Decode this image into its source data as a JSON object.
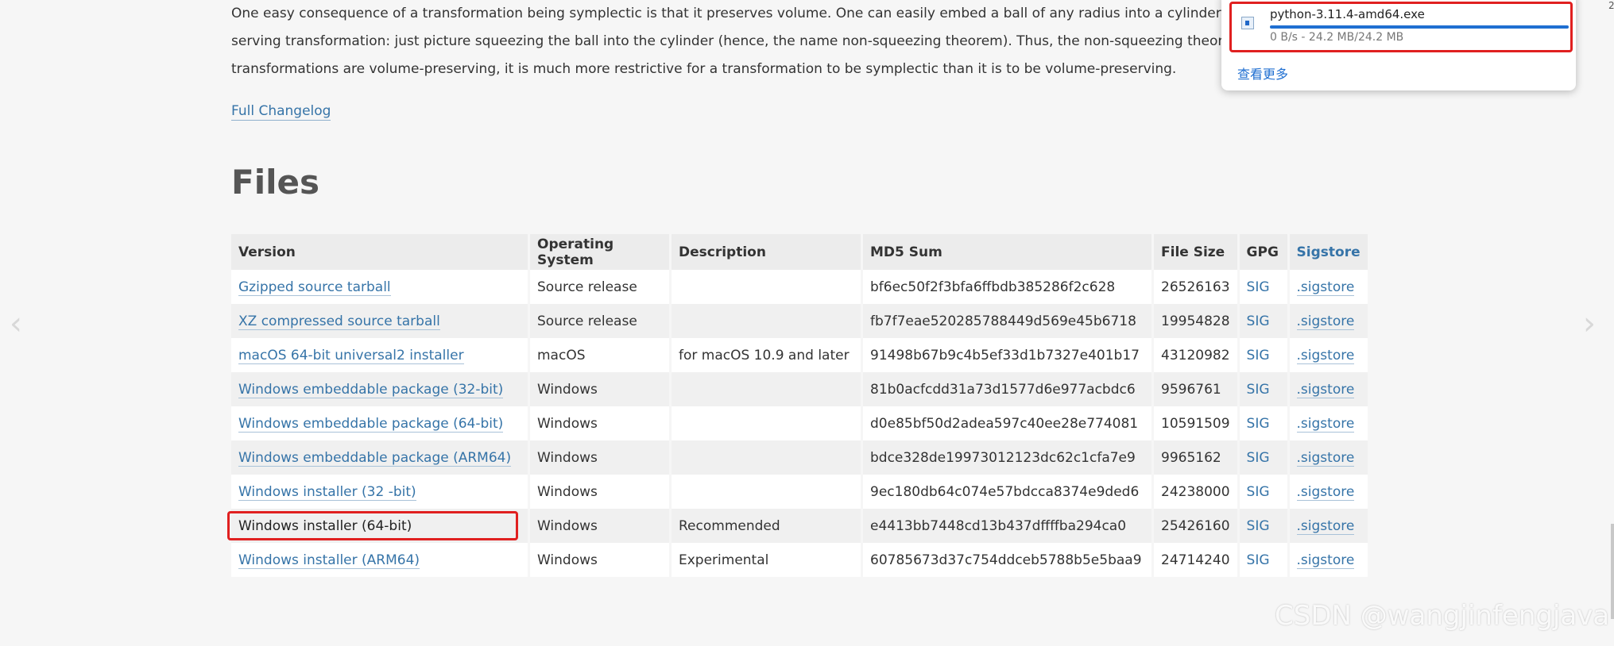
{
  "paragraph": {
    "line1": "One easy consequence of a transformation being symplectic is that it preserves volume. One can easily embed a ball of any radius into a cylinder of any other radi",
    "line2": "serving transformation: just picture squeezing the ball into the cylinder (hence, the name non-squeezing theorem). Thus, the non-squeezing theorem tells us that",
    "line3": "transformations are volume-preserving, it is much more restrictive for a transformation to be symplectic than it is to be volume-preserving."
  },
  "changelog_link": "Full Changelog",
  "files_title": "Files",
  "table": {
    "headers": {
      "version": "Version",
      "os": "Operating System",
      "description": "Description",
      "md5": "MD5 Sum",
      "size": "File Size",
      "gpg": "GPG",
      "sigstore": "Sigstore"
    },
    "rows": [
      {
        "version": "Gzipped source tarball",
        "os": "Source release",
        "description": "",
        "md5": "bf6ec50f2f3bfa6ffbdb385286f2c628",
        "size": "26526163",
        "gpg": "SIG",
        "sigstore": ".sigstore"
      },
      {
        "version": "XZ compressed source tarball",
        "os": "Source release",
        "description": "",
        "md5": "fb7f7eae520285788449d569e45b6718",
        "size": "19954828",
        "gpg": "SIG",
        "sigstore": ".sigstore"
      },
      {
        "version": "macOS 64-bit universal2 installer",
        "os": "macOS",
        "description": "for macOS 10.9 and later",
        "md5": "91498b67b9c4b5ef33d1b7327e401b17",
        "size": "43120982",
        "gpg": "SIG",
        "sigstore": ".sigstore"
      },
      {
        "version": "Windows embeddable package (32-bit)",
        "os": "Windows",
        "description": "",
        "md5": "81b0acfcdd31a73d1577d6e977acbdc6",
        "size": "9596761",
        "gpg": "SIG",
        "sigstore": ".sigstore"
      },
      {
        "version": "Windows embeddable package (64-bit)",
        "os": "Windows",
        "description": "",
        "md5": "d0e85bf50d2adea597c40ee28e774081",
        "size": "10591509",
        "gpg": "SIG",
        "sigstore": ".sigstore"
      },
      {
        "version": "Windows embeddable package (ARM64)",
        "os": "Windows",
        "description": "",
        "md5": "bdce328de19973012123dc62c1cfa7e9",
        "size": "9965162",
        "gpg": "SIG",
        "sigstore": ".sigstore"
      },
      {
        "version": "Windows installer (32 -bit)",
        "os": "Windows",
        "description": "",
        "md5": "9ec180db64c074e57bdcca8374e9ded6",
        "size": "24238000",
        "gpg": "SIG",
        "sigstore": ".sigstore"
      },
      {
        "version": "Windows installer (64-bit)",
        "os": "Windows",
        "description": "Recommended",
        "md5": "e4413bb7448cd13b437dffffba294ca0",
        "size": "25426160",
        "gpg": "SIG",
        "sigstore": ".sigstore"
      },
      {
        "version": "Windows installer (ARM64)",
        "os": "Windows",
        "description": "Experimental",
        "md5": "60785673d37c754ddceb5788b5e5baa9",
        "size": "24714240",
        "gpg": "SIG",
        "sigstore": ".sigstore"
      }
    ]
  },
  "download_panel": {
    "file_name": "python-3.11.4-amd64.exe",
    "status": "0 B/s - 24.2 MB/24.2 MB",
    "progress_fraction": 1.0,
    "see_more": "查看更多",
    "file_icon": "file-icon"
  },
  "watermark": "CSDN @wangjinfengjava",
  "corner_mark": "2",
  "colors": {
    "link": "#3674a8",
    "highlight_border": "#e02020",
    "progress": "#1f6fd1"
  }
}
